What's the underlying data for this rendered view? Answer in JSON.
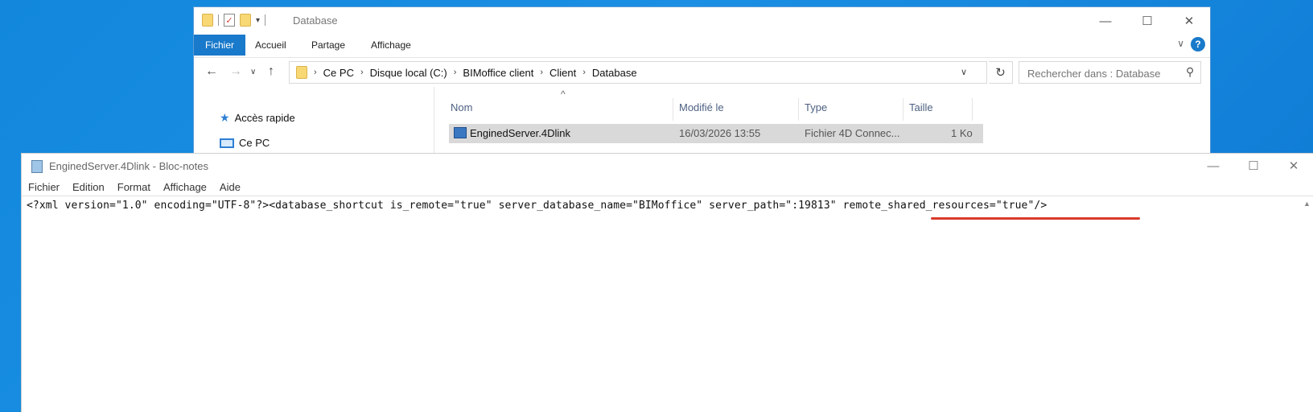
{
  "explorer": {
    "title": "Database",
    "ribbon_tabs": [
      "Fichier",
      "Accueil",
      "Partage",
      "Affichage"
    ],
    "help": "?",
    "breadcrumb": [
      "Ce PC",
      "Disque local (C:)",
      "BIMoffice client",
      "Client",
      "Database"
    ],
    "search_placeholder": "Rechercher dans : Database",
    "nav": [
      "Accès rapide",
      "Ce PC"
    ],
    "columns": [
      "Nom",
      "Modifié le",
      "Type",
      "Taille"
    ],
    "file": {
      "name": "EnginedServer.4Dlink",
      "modified": "16/03/2026 13:55",
      "type": "Fichier 4D Connec...",
      "size": "1 Ko"
    }
  },
  "notepad": {
    "title": "EnginedServer.4Dlink - Bloc-notes",
    "menu": [
      "Fichier",
      "Edition",
      "Format",
      "Affichage",
      "Aide"
    ],
    "content": "<?xml version=\"1.0\" encoding=\"UTF-8\"?><database_shortcut is_remote=\"true\" server_database_name=\"BIMoffice\" server_path=\":19813\" remote_shared_resources=\"true\"/>",
    "highlight_color": "#d93a2b"
  },
  "icons": [
    "folder-icon",
    "checklist-icon",
    "arrow-left-icon",
    "arrow-right-icon",
    "chevron-down-icon",
    "arrow-up-icon",
    "refresh-icon",
    "search-icon",
    "star-icon",
    "pc-icon",
    "link-file-icon",
    "notepad-icon",
    "minimize-icon",
    "maximize-icon",
    "close-icon"
  ]
}
